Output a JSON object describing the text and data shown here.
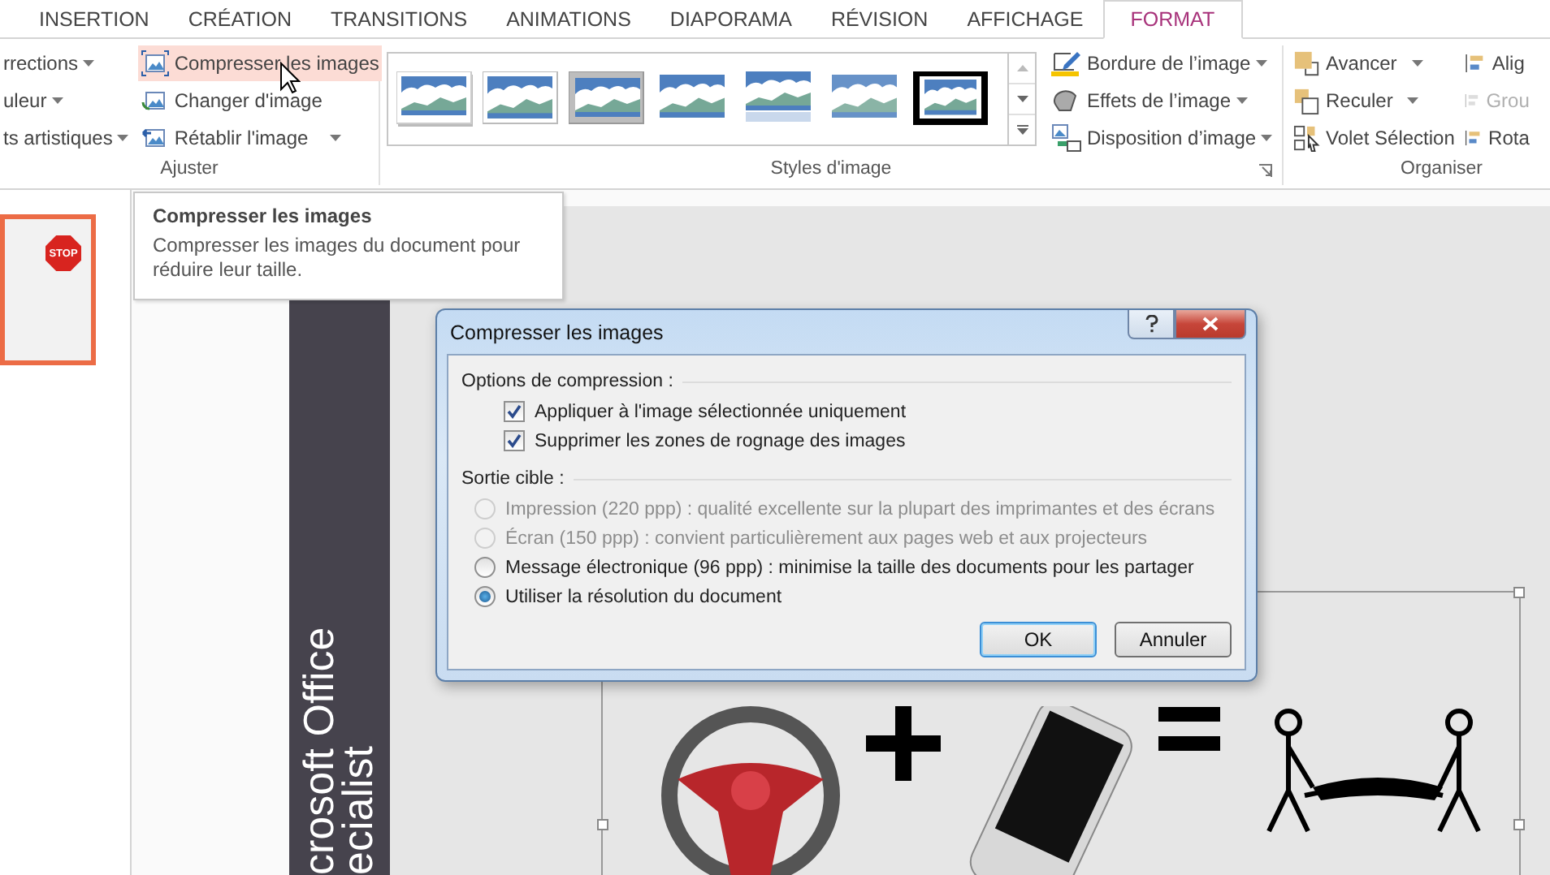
{
  "ribbon_tabs": [
    {
      "label": "INSERTION",
      "selected": false
    },
    {
      "label": "CRÉATION",
      "selected": false
    },
    {
      "label": "TRANSITIONS",
      "selected": false
    },
    {
      "label": "ANIMATIONS",
      "selected": false
    },
    {
      "label": "DIAPORAMA",
      "selected": false
    },
    {
      "label": "RÉVISION",
      "selected": false
    },
    {
      "label": "AFFICHAGE",
      "selected": false
    },
    {
      "label": "FORMAT",
      "selected": true
    }
  ],
  "adjust_group": {
    "label": "Ajuster",
    "cut_commands": [
      {
        "label": "rrections",
        "dropdown": true
      },
      {
        "label": "uleur",
        "dropdown": true
      },
      {
        "label": "ts artistiques",
        "dropdown": true
      }
    ],
    "commands": [
      {
        "label": "Compresser les images",
        "hovered": true,
        "dropdown": false
      },
      {
        "label": "Changer d'image",
        "hovered": false,
        "dropdown": false
      },
      {
        "label": "Rétablir l'image",
        "hovered": false,
        "dropdown": true
      }
    ]
  },
  "styles_group": {
    "label": "Styles d'image",
    "gallery": [
      {
        "kind": "shadow"
      },
      {
        "kind": "frame"
      },
      {
        "kind": "plate"
      },
      {
        "kind": "plain"
      },
      {
        "kind": "reflect"
      },
      {
        "kind": "soft"
      },
      {
        "kind": "thick"
      }
    ],
    "commands": [
      {
        "label": "Bordure de l’image",
        "dropdown": true
      },
      {
        "label": "Effets de l’image",
        "dropdown": true
      },
      {
        "label": "Disposition d’image",
        "dropdown": true
      }
    ]
  },
  "arrange_group": {
    "label": "Organiser",
    "commands": [
      {
        "label": "Avancer",
        "dropdown": true,
        "disabled": false
      },
      {
        "label": "Reculer",
        "dropdown": true,
        "disabled": false
      },
      {
        "label": "Volet Sélection",
        "dropdown": false,
        "disabled": false
      }
    ],
    "cut_commands": [
      {
        "label": "Alig",
        "disabled": false
      },
      {
        "label": "Grou",
        "disabled": true
      },
      {
        "label": "Rota",
        "disabled": false
      }
    ]
  },
  "tooltip": {
    "title": "Compresser les images",
    "text": "Compresser les images du document pour réduire leur taille."
  },
  "slide_thumbnail": {
    "selected": true,
    "sign_text": "STOP"
  },
  "slide": {
    "side_lines": [
      "crosoft Office",
      "ecialist"
    ]
  },
  "dialog": {
    "title": "Compresser les images",
    "sections": [
      {
        "label": "Options de compression :",
        "options": [
          {
            "kind": "checkbox",
            "label": "Appliquer à l'image sélectionnée uniquement",
            "checked": true,
            "disabled": false
          },
          {
            "kind": "checkbox",
            "label": "Supprimer les zones de rognage des images",
            "checked": true,
            "disabled": false
          }
        ]
      },
      {
        "label": "Sortie cible :",
        "options": [
          {
            "kind": "radio",
            "label": "Impression (220 ppp) : qualité excellente sur la plupart des imprimantes et des écrans",
            "selected": false,
            "disabled": true
          },
          {
            "kind": "radio",
            "label": "Écran (150 ppp) : convient particulièrement aux pages web et aux projecteurs",
            "selected": false,
            "disabled": true
          },
          {
            "kind": "radio",
            "label": "Message électronique (96 ppp) : minimise la taille des documents pour les partager",
            "selected": false,
            "disabled": false
          },
          {
            "kind": "radio",
            "label": "Utiliser la résolution du document",
            "selected": true,
            "disabled": false
          }
        ]
      }
    ],
    "buttons": [
      {
        "label": "OK",
        "default": true
      },
      {
        "label": "Annuler",
        "default": false
      }
    ]
  }
}
